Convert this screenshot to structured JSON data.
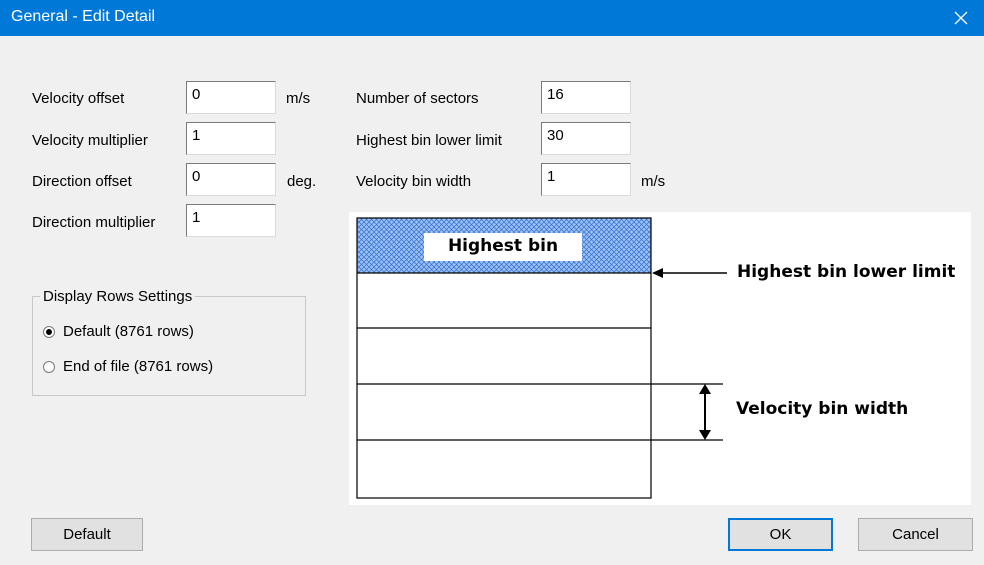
{
  "window": {
    "title": "General - Edit Detail",
    "close_icon": "close-icon"
  },
  "left_fields": [
    {
      "label": "Velocity offset",
      "value": "0",
      "unit": "m/s"
    },
    {
      "label": "Velocity multiplier",
      "value": "1",
      "unit": ""
    },
    {
      "label": "Direction offset",
      "value": "0",
      "unit": "deg."
    },
    {
      "label": "Direction multiplier",
      "value": "1",
      "unit": ""
    }
  ],
  "right_fields": [
    {
      "label": "Number of sectors",
      "value": "16",
      "unit": ""
    },
    {
      "label": "Highest bin lower limit",
      "value": "30",
      "unit": ""
    },
    {
      "label": "Velocity bin width",
      "value": "1",
      "unit": "m/s"
    }
  ],
  "display_rows": {
    "title": "Display Rows Settings",
    "options": [
      {
        "label": "Default (8761 rows)",
        "checked": true
      },
      {
        "label": "End of file (8761 rows)",
        "checked": false
      }
    ]
  },
  "diagram": {
    "highest_bin_label": "Highest bin",
    "lower_limit_label": "Highest bin lower limit",
    "bin_width_label": "Velocity bin width",
    "hatch_color": "#2f6fd6"
  },
  "buttons": {
    "default": "Default",
    "ok": "OK",
    "cancel": "Cancel"
  }
}
